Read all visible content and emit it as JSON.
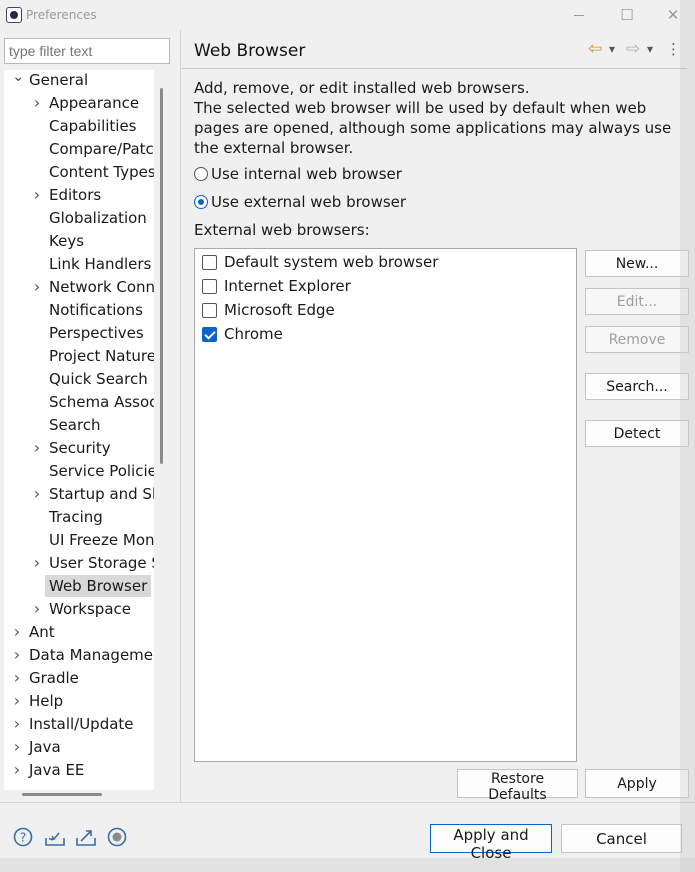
{
  "window": {
    "title": "Preferences",
    "minimize_icon": "minimize-icon",
    "maximize_glyph": "☐",
    "close_glyph": "✕"
  },
  "filter": {
    "placeholder": "type filter text"
  },
  "tree": {
    "general": {
      "label": "General",
      "children": [
        "Appearance",
        "Capabilities",
        "Compare/Patch",
        "Content Types",
        "Editors",
        "Globalization",
        "Keys",
        "Link Handlers",
        "Network Conne",
        "Notifications",
        "Perspectives",
        "Project Natures",
        "Quick Search",
        "Schema Associa",
        "Search",
        "Security",
        "Service Policies",
        "Startup and Sh",
        "Tracing",
        "UI Freeze Moni",
        "User Storage Se",
        "Web Browser",
        "Workspace"
      ],
      "expandable_children": [
        "Appearance",
        "Editors",
        "Network Conne",
        "Security",
        "Startup and Sh",
        "User Storage Se",
        "Workspace"
      ],
      "selected": "Web Browser"
    },
    "top_level": [
      "Ant",
      "Data Managemen",
      "Gradle",
      "Help",
      "Install/Update",
      "Java",
      "Java EE"
    ]
  },
  "page": {
    "title": "Web Browser",
    "description_line1": "Add, remove, or edit installed web browsers.",
    "description_line2": "The selected web browser will be used by default when web pages are opened, although some applications may always use the external browser.",
    "radio_internal": "Use internal web browser",
    "radio_external": "Use external web browser",
    "selected_radio": "external",
    "list_label": "External web browsers:",
    "browsers": [
      {
        "label": "Default system web browser",
        "checked": false
      },
      {
        "label": "Internet Explorer",
        "checked": false
      },
      {
        "label": "Microsoft Edge",
        "checked": false
      },
      {
        "label": "Chrome",
        "checked": true
      }
    ],
    "buttons": {
      "new": "New...",
      "edit": "Edit...",
      "remove": "Remove",
      "search": "Search...",
      "detect": "Detect",
      "restore_defaults": "Restore Defaults",
      "apply": "Apply"
    },
    "nav": {
      "back_glyph": "⇦",
      "forward_glyph": "⇨",
      "dropdown_glyph": "▾",
      "menu_glyph": "⋮"
    }
  },
  "footer": {
    "apply_close": "Apply and Close",
    "cancel": "Cancel",
    "icons": [
      "help-icon",
      "import-icon",
      "export-icon",
      "record-icon"
    ]
  },
  "colors": {
    "accent": "#0b63c8",
    "selection": "#d9d9d9",
    "background": "#f0f0f0"
  }
}
